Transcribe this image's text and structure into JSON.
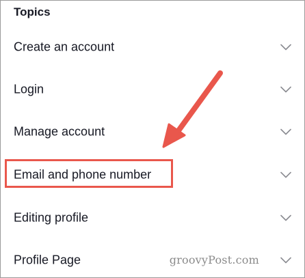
{
  "topics": {
    "heading": "Topics",
    "items": [
      {
        "label": "Create an account"
      },
      {
        "label": "Login"
      },
      {
        "label": "Manage account"
      },
      {
        "label": "Email and phone number"
      },
      {
        "label": "Editing profile"
      },
      {
        "label": "Profile Page"
      }
    ]
  },
  "annotations": {
    "highlighted_item": "Email and phone number",
    "accent_color": "#e9574c",
    "watermark": "groovyPost.com"
  }
}
